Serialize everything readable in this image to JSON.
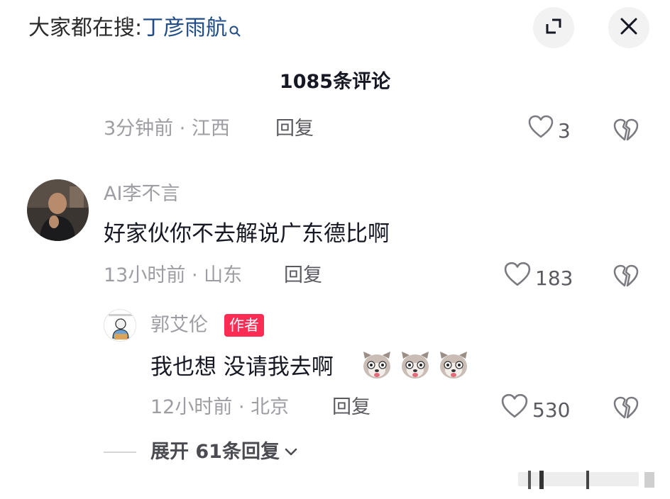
{
  "header": {
    "search_prefix": "大家都在搜:",
    "search_keyword": "丁彦雨航",
    "icons": [
      "search-icon",
      "expand-icon",
      "close-icon"
    ]
  },
  "comment_count_title": "1085条评论",
  "comments": [
    {
      "time_location": "3分钟前 · 江西",
      "reply_label": "回复",
      "like_count": "3"
    },
    {
      "username": "AI李不言",
      "content": "好家伙你不去解说广东德比啊",
      "time_location": "13小时前 · 山东",
      "reply_label": "回复",
      "like_count": "183",
      "replies": [
        {
          "username": "郭艾伦",
          "badge": "作者",
          "content": "我也想 没请我去啊",
          "emojis": [
            "dog-face-emoji",
            "dog-face-emoji",
            "dog-face-emoji"
          ],
          "time_location": "12小时前 · 北京",
          "reply_label": "回复",
          "like_count": "530"
        }
      ],
      "expand_replies_label": "展开 61条回复"
    }
  ],
  "colors": {
    "keyword": "#1f4c87",
    "badge": "#fe2c55",
    "meta": "#9d9da3"
  }
}
